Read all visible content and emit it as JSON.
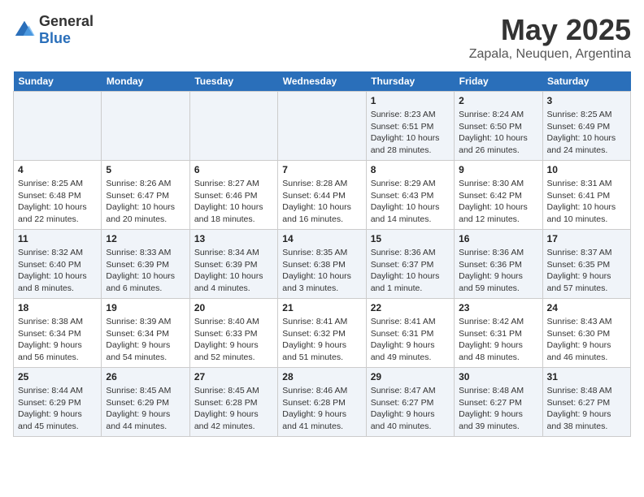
{
  "logo": {
    "general": "General",
    "blue": "Blue"
  },
  "header": {
    "month": "May 2025",
    "location": "Zapala, Neuquen, Argentina"
  },
  "weekdays": [
    "Sunday",
    "Monday",
    "Tuesday",
    "Wednesday",
    "Thursday",
    "Friday",
    "Saturday"
  ],
  "weeks": [
    [
      {
        "day": "",
        "info": ""
      },
      {
        "day": "",
        "info": ""
      },
      {
        "day": "",
        "info": ""
      },
      {
        "day": "",
        "info": ""
      },
      {
        "day": "1",
        "info": "Sunrise: 8:23 AM\nSunset: 6:51 PM\nDaylight: 10 hours\nand 28 minutes."
      },
      {
        "day": "2",
        "info": "Sunrise: 8:24 AM\nSunset: 6:50 PM\nDaylight: 10 hours\nand 26 minutes."
      },
      {
        "day": "3",
        "info": "Sunrise: 8:25 AM\nSunset: 6:49 PM\nDaylight: 10 hours\nand 24 minutes."
      }
    ],
    [
      {
        "day": "4",
        "info": "Sunrise: 8:25 AM\nSunset: 6:48 PM\nDaylight: 10 hours\nand 22 minutes."
      },
      {
        "day": "5",
        "info": "Sunrise: 8:26 AM\nSunset: 6:47 PM\nDaylight: 10 hours\nand 20 minutes."
      },
      {
        "day": "6",
        "info": "Sunrise: 8:27 AM\nSunset: 6:46 PM\nDaylight: 10 hours\nand 18 minutes."
      },
      {
        "day": "7",
        "info": "Sunrise: 8:28 AM\nSunset: 6:44 PM\nDaylight: 10 hours\nand 16 minutes."
      },
      {
        "day": "8",
        "info": "Sunrise: 8:29 AM\nSunset: 6:43 PM\nDaylight: 10 hours\nand 14 minutes."
      },
      {
        "day": "9",
        "info": "Sunrise: 8:30 AM\nSunset: 6:42 PM\nDaylight: 10 hours\nand 12 minutes."
      },
      {
        "day": "10",
        "info": "Sunrise: 8:31 AM\nSunset: 6:41 PM\nDaylight: 10 hours\nand 10 minutes."
      }
    ],
    [
      {
        "day": "11",
        "info": "Sunrise: 8:32 AM\nSunset: 6:40 PM\nDaylight: 10 hours\nand 8 minutes."
      },
      {
        "day": "12",
        "info": "Sunrise: 8:33 AM\nSunset: 6:39 PM\nDaylight: 10 hours\nand 6 minutes."
      },
      {
        "day": "13",
        "info": "Sunrise: 8:34 AM\nSunset: 6:39 PM\nDaylight: 10 hours\nand 4 minutes."
      },
      {
        "day": "14",
        "info": "Sunrise: 8:35 AM\nSunset: 6:38 PM\nDaylight: 10 hours\nand 3 minutes."
      },
      {
        "day": "15",
        "info": "Sunrise: 8:36 AM\nSunset: 6:37 PM\nDaylight: 10 hours\nand 1 minute."
      },
      {
        "day": "16",
        "info": "Sunrise: 8:36 AM\nSunset: 6:36 PM\nDaylight: 9 hours\nand 59 minutes."
      },
      {
        "day": "17",
        "info": "Sunrise: 8:37 AM\nSunset: 6:35 PM\nDaylight: 9 hours\nand 57 minutes."
      }
    ],
    [
      {
        "day": "18",
        "info": "Sunrise: 8:38 AM\nSunset: 6:34 PM\nDaylight: 9 hours\nand 56 minutes."
      },
      {
        "day": "19",
        "info": "Sunrise: 8:39 AM\nSunset: 6:34 PM\nDaylight: 9 hours\nand 54 minutes."
      },
      {
        "day": "20",
        "info": "Sunrise: 8:40 AM\nSunset: 6:33 PM\nDaylight: 9 hours\nand 52 minutes."
      },
      {
        "day": "21",
        "info": "Sunrise: 8:41 AM\nSunset: 6:32 PM\nDaylight: 9 hours\nand 51 minutes."
      },
      {
        "day": "22",
        "info": "Sunrise: 8:41 AM\nSunset: 6:31 PM\nDaylight: 9 hours\nand 49 minutes."
      },
      {
        "day": "23",
        "info": "Sunrise: 8:42 AM\nSunset: 6:31 PM\nDaylight: 9 hours\nand 48 minutes."
      },
      {
        "day": "24",
        "info": "Sunrise: 8:43 AM\nSunset: 6:30 PM\nDaylight: 9 hours\nand 46 minutes."
      }
    ],
    [
      {
        "day": "25",
        "info": "Sunrise: 8:44 AM\nSunset: 6:29 PM\nDaylight: 9 hours\nand 45 minutes."
      },
      {
        "day": "26",
        "info": "Sunrise: 8:45 AM\nSunset: 6:29 PM\nDaylight: 9 hours\nand 44 minutes."
      },
      {
        "day": "27",
        "info": "Sunrise: 8:45 AM\nSunset: 6:28 PM\nDaylight: 9 hours\nand 42 minutes."
      },
      {
        "day": "28",
        "info": "Sunrise: 8:46 AM\nSunset: 6:28 PM\nDaylight: 9 hours\nand 41 minutes."
      },
      {
        "day": "29",
        "info": "Sunrise: 8:47 AM\nSunset: 6:27 PM\nDaylight: 9 hours\nand 40 minutes."
      },
      {
        "day": "30",
        "info": "Sunrise: 8:48 AM\nSunset: 6:27 PM\nDaylight: 9 hours\nand 39 minutes."
      },
      {
        "day": "31",
        "info": "Sunrise: 8:48 AM\nSunset: 6:27 PM\nDaylight: 9 hours\nand 38 minutes."
      }
    ]
  ]
}
